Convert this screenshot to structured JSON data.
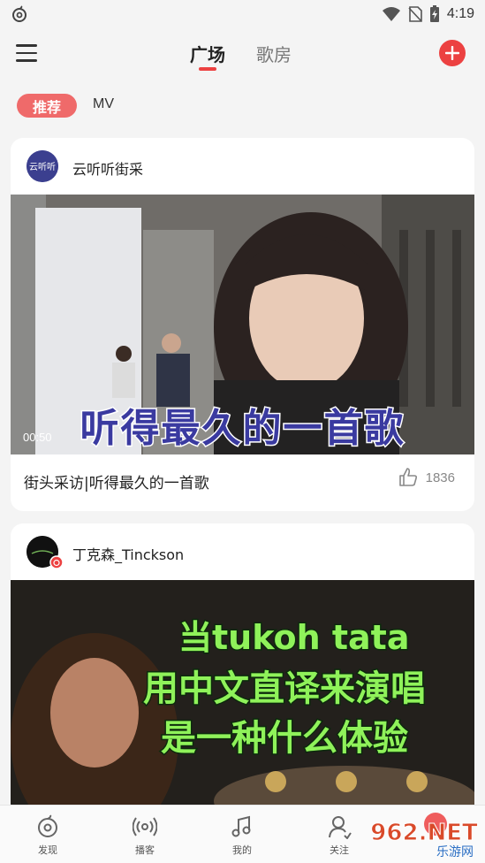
{
  "status_bar": {
    "time": "4:19"
  },
  "top_nav": {
    "tabs": [
      {
        "label": "广场",
        "active": true
      },
      {
        "label": "歌房",
        "active": false
      }
    ]
  },
  "filters": {
    "recommend": "推荐",
    "mv": "MV"
  },
  "feed": [
    {
      "author": "云听听街采",
      "avatar_text": "云听听",
      "caption_lines": [
        "听得最久的一首歌"
      ],
      "duration": "00:50",
      "title": "街头采访|听得最久的一首歌",
      "likes": "1836"
    },
    {
      "author": "丁克森_Tinckson",
      "caption_lines": [
        "当tukoh tata",
        "用中文直译来演唱",
        "是一种什么体验"
      ]
    }
  ],
  "bottom_nav": [
    {
      "label": "发现",
      "icon": "discover-icon"
    },
    {
      "label": "播客",
      "icon": "podcast-icon"
    },
    {
      "label": "我的",
      "icon": "music-note-icon"
    },
    {
      "label": "关注",
      "icon": "user-icon"
    }
  ],
  "watermark": {
    "text": "962.NET",
    "sub": "乐游网"
  },
  "colors": {
    "accent": "#ec4141",
    "chip": "#ef6a6a",
    "caption_blue": "#3a3aa0",
    "caption_green": "#8ff25a"
  }
}
